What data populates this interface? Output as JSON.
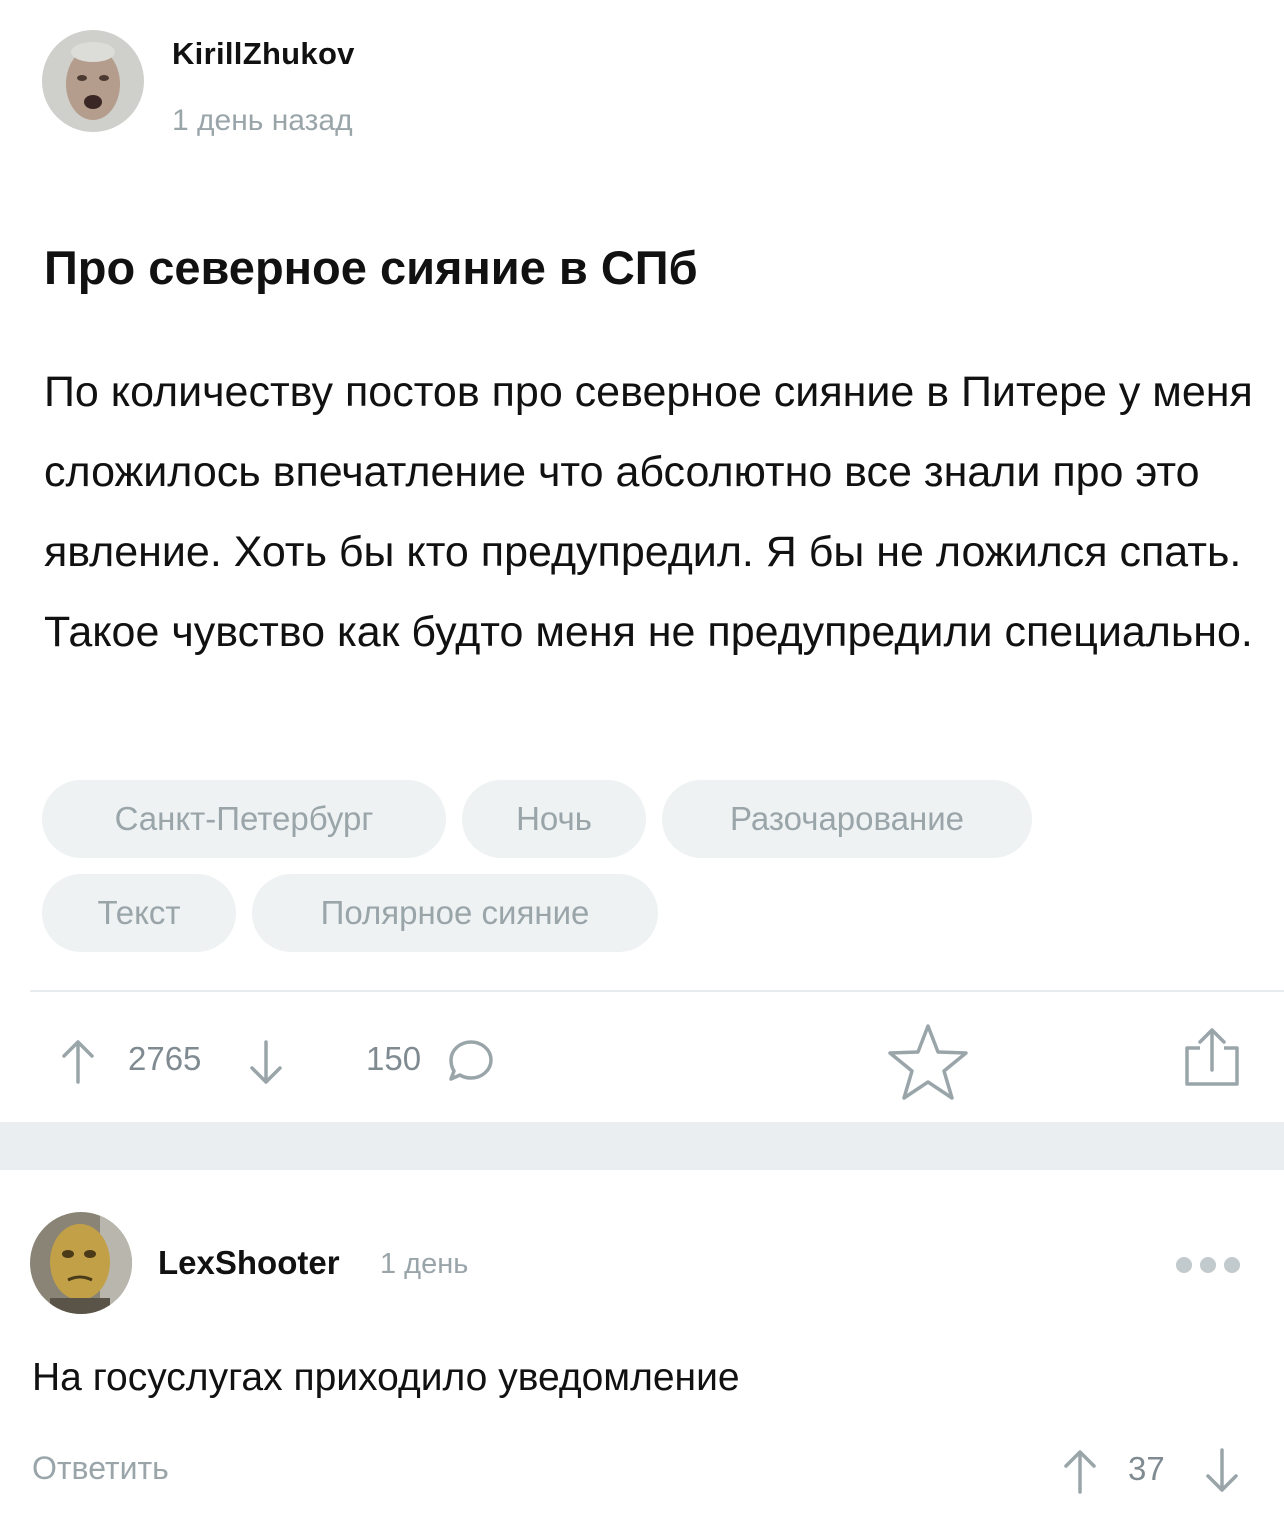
{
  "post": {
    "author": "KirillZhukov",
    "time": "1 день назад",
    "title": "Про северное сияние в СПб",
    "body": "По количеству постов про северное сияние в Питере у меня сложилось впечатление что абсолютно все знали про это явление. Хоть бы кто предупредил. Я бы не ложился спать. Такое чувство как будто меня не предупредили специально.",
    "tags": [
      "Санкт-Петербург",
      "Ночь",
      "Разочарование",
      "Текст",
      "Полярное сияние"
    ],
    "rating": "2765",
    "comments_count": "150",
    "icons": {
      "upvote": "arrow-up-icon",
      "downvote": "arrow-down-icon",
      "comments": "speech-bubble-icon",
      "save": "star-icon",
      "share": "share-icon"
    }
  },
  "comment": {
    "author": "LexShooter",
    "time": "1 день",
    "text": "На госуслугах приходило уведомление",
    "reply_label": "Ответить",
    "rating": "37",
    "icons": {
      "more": "more-dots-icon",
      "upvote": "arrow-up-icon",
      "downvote": "arrow-down-icon"
    }
  },
  "colors": {
    "icon_gray": "#9aa5aa",
    "tag_bg": "#eef2f3",
    "separator": "#eaeef0"
  }
}
